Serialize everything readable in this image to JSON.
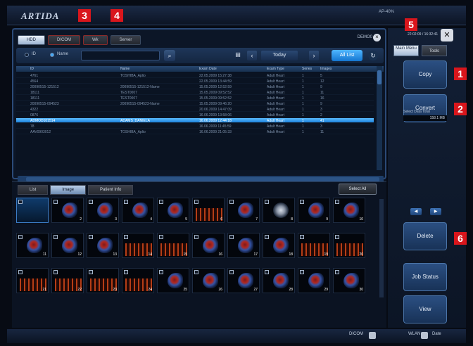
{
  "app": {
    "logo": "ARTIDA",
    "status": "AP-40%"
  },
  "markers": {
    "m1": "1",
    "m2": "2",
    "m3": "3",
    "m4": "4",
    "m5": "5",
    "m6": "6"
  },
  "top_tabs": [
    "HDD",
    "DICOM",
    "Wk",
    "Server"
  ],
  "demo": "DEMO0",
  "search": {
    "id_label": "ID",
    "name_label": "Name",
    "today": "Today",
    "all_list": "All List"
  },
  "table": {
    "headers": [
      "ID",
      "Name",
      "Exam Date",
      "Exam Type",
      "Series",
      "Images"
    ],
    "rows": [
      [
        "4761",
        "TOSHIBA_Aplio",
        "22.05.2009 15:27:38",
        "Adult Heart",
        "1",
        "5"
      ],
      [
        "4564",
        "",
        "22.05.2009 13:44:59",
        "Adult Heart",
        "1",
        "12"
      ],
      [
        "20090515-121512",
        "20090515-121512-Name",
        "15.05.2009 12:52:59",
        "Adult Heart",
        "1",
        "9"
      ],
      [
        "18111",
        "TEST0007",
        "15.05.2009 09:52:52",
        "Adult Heart",
        "1",
        "11"
      ],
      [
        "18111",
        "TEST0007",
        "15.05.2009 09:52:52",
        "Adult Heart",
        "1",
        "16"
      ],
      [
        "20090515-094523",
        "20090515-094523-Name",
        "15.05.2009 09:46:20",
        "Adult Heart",
        "1",
        "9"
      ],
      [
        "4322",
        "",
        "20.06.2009 14:47:09",
        "Adult Heart",
        "1",
        "3"
      ],
      [
        "0876",
        "",
        "16.06.2009 13:58:06",
        "Adult Heart",
        "1",
        "2"
      ],
      [
        "ADMOD101514",
        "ADAMS_DANIELA",
        "16.06.2009 12:44:18",
        "Adult Heart",
        "1",
        "41"
      ],
      [
        "78",
        "",
        "16.06.2009 11:45:59",
        "Adult Heart",
        "1",
        "3"
      ],
      [
        "AAV0903012",
        "TOSHIBA_Aplio",
        "16.06.2009 21:05:33",
        "Adult Heart",
        "1",
        "11"
      ]
    ]
  },
  "bottom_tabs": [
    "List",
    "Image",
    "Patient Info"
  ],
  "select_all": "Select All",
  "thumbs": [
    "",
    "2",
    "3",
    "4",
    "5",
    "6",
    "7",
    "8",
    "9",
    "10",
    "11",
    "12",
    "13",
    "14",
    "15",
    "16",
    "17",
    "18",
    "19",
    "20",
    "21",
    "22",
    "23",
    "24",
    "25",
    "26",
    "27",
    "28",
    "29",
    "30"
  ],
  "right": {
    "clock": "22:02:09 / 16:32:41",
    "tabs": [
      "Main Menu",
      "Tools"
    ],
    "copy": "Copy",
    "convert": "Convert",
    "data_total_label": "Select Data Total",
    "data_total_value": "158.1 MB",
    "delete": "Delete",
    "job_status": "Job Status",
    "view": "View"
  },
  "status": {
    "dicom": "DICOM",
    "wlan": "WLAN",
    "wlan_sub": "Date"
  }
}
